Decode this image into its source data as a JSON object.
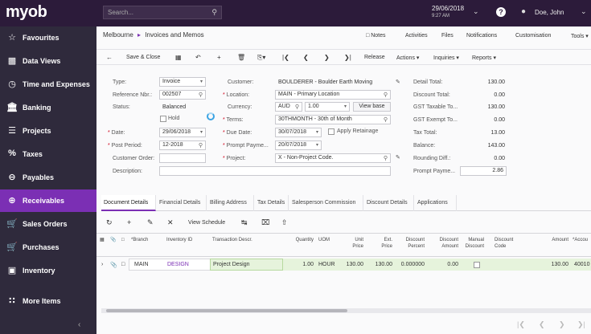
{
  "header": {
    "logo": "myob",
    "search_placeholder": "Search...",
    "date": "29/06/2018",
    "time": "9:27 AM",
    "user": "Doe, John"
  },
  "sidebar": {
    "items": [
      {
        "label": "Favourites",
        "icon": "star-icon"
      },
      {
        "label": "Data Views",
        "icon": "chart-icon"
      },
      {
        "label": "Time and Expenses",
        "icon": "clock-icon"
      },
      {
        "label": "Banking",
        "icon": "bank-icon"
      },
      {
        "label": "Projects",
        "icon": "list-icon"
      },
      {
        "label": "Taxes",
        "icon": "percent-icon"
      },
      {
        "label": "Payables",
        "icon": "minus-circle-icon"
      },
      {
        "label": "Receivables",
        "icon": "plus-circle-icon",
        "active": true
      },
      {
        "label": "Sales Orders",
        "icon": "cart-icon"
      },
      {
        "label": "Purchases",
        "icon": "cart-icon"
      },
      {
        "label": "Inventory",
        "icon": "truck-icon"
      },
      {
        "label": "More Items",
        "icon": "grid-icon"
      }
    ]
  },
  "breadcrumb": {
    "company": "Melbourne",
    "screen": "Invoices and Memos"
  },
  "toplinks": [
    "Notes",
    "Activities",
    "Files",
    "Notifications",
    "Customisation",
    "Tools"
  ],
  "toolbar": {
    "save_close": "Save & Close",
    "release": "Release",
    "actions": "Actions",
    "inquiries": "Inquiries",
    "reports": "Reports"
  },
  "form": {
    "type_label": "Type:",
    "type": "Invoice",
    "ref_label": "Reference Nbr.:",
    "ref": "002507",
    "status_label": "Status:",
    "status": "Balanced",
    "hold_label": "Hold",
    "date_label": "Date:",
    "date": "29/06/2018",
    "post_label": "Post Period:",
    "post": "12-2018",
    "custorder_label": "Customer Order:",
    "custorder": "",
    "desc_label": "Description:",
    "desc": "",
    "customer_label": "Customer:",
    "customer": "BOULDERER - Boulder Earth Moving",
    "location_label": "Location:",
    "location": "MAIN - Primary Location",
    "currency_label": "Currency:",
    "currency": "AUD",
    "rate": "1.00",
    "viewbase": "View base",
    "terms_label": "Terms:",
    "terms": "30THMONTH - 30th of Month",
    "duedate_label": "Due Date:",
    "duedate": "30/07/2018",
    "retainage_label": "Apply Retainage",
    "prompt_label": "Prompt Payme...",
    "prompt": "20/07/2018",
    "project_label": "Project:",
    "project": "X - Non-Project Code.",
    "detail_total_label": "Detail Total:",
    "detail_total": "130.00",
    "discount_total_label": "Discount Total:",
    "discount_total": "0.00",
    "gst_taxable_label": "GST Taxable To...",
    "gst_taxable": "130.00",
    "gst_exempt_label": "GST Exempt To...",
    "gst_exempt": "0.00",
    "tax_total_label": "Tax Total:",
    "tax_total": "13.00",
    "balance_label": "Balance:",
    "balance": "143.00",
    "rounding_label": "Rounding Diff.:",
    "rounding": "0.00",
    "prompt_pay_label": "Prompt Payme...",
    "prompt_pay": "2.86"
  },
  "tabs": [
    "Document Details",
    "Financial Details",
    "Billing Address",
    "Tax Details",
    "Salesperson Commission",
    "Discount Details",
    "Applications"
  ],
  "grid_tools": {
    "view_schedule": "View Schedule"
  },
  "grid": {
    "headers": {
      "branch": "*Branch",
      "inventory": "Inventory ID",
      "descr": "Transaction Descr.",
      "qty": "Quantity",
      "uom": "UOM",
      "unit": "Unit Price",
      "ext": "Ext. Price",
      "discpct": "Discount Percent",
      "discamt": "Discount Amount",
      "manual": "Manual Discount",
      "disccode": "Discount Code",
      "amount": "Amount",
      "account": "*Accou"
    },
    "row": {
      "branch": "MAIN",
      "inventory": "DESIGN",
      "descr": "Project Design",
      "qty": "1.00",
      "uom": "HOUR",
      "unit": "130.00",
      "ext": "130.00",
      "discpct": "0.000000",
      "discamt": "0.00",
      "amount": "130.00",
      "account": "40010"
    }
  }
}
